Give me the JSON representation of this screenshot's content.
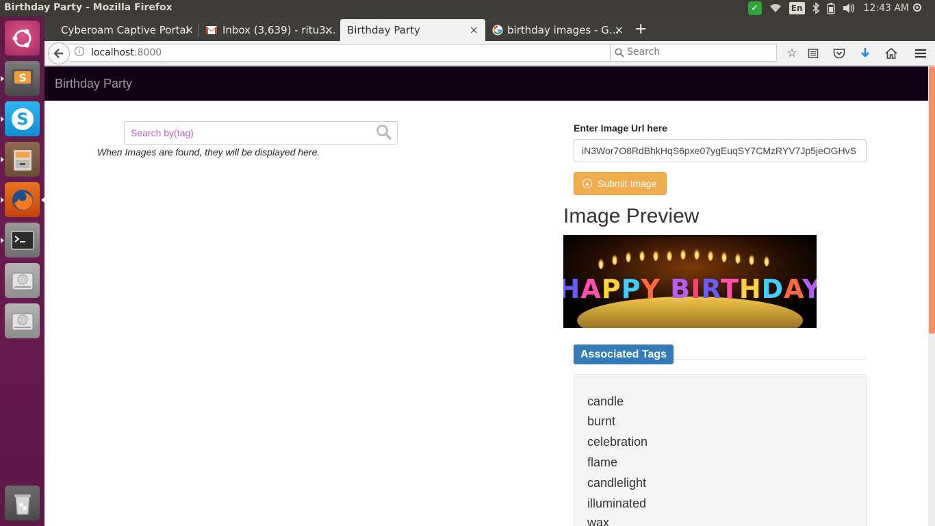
{
  "os": {
    "window_title": "Birthday Party - Mozilla Firefox",
    "keyboard_layout": "En",
    "clock": "12:43 AM"
  },
  "browser": {
    "tabs": [
      {
        "label": "Cyberoam Captive Portal",
        "favicon": "none"
      },
      {
        "label": "Inbox (3,639) - ritu3…",
        "favicon": "gmail-icon"
      },
      {
        "label": "Birthday Party",
        "favicon": "none",
        "active": true
      },
      {
        "label": "birthday images - G…",
        "favicon": "google-icon"
      }
    ],
    "close_glyph": "×",
    "new_tab_glyph": "+",
    "url_host": "localhost",
    "url_port": ":8000",
    "search_placeholder": "Search"
  },
  "page": {
    "brand": "Birthday Party",
    "tag_search_placeholder": "Search by(tag)",
    "results_hint": "When Images are found, they will be displayed here.",
    "url_label": "Enter Image Url here",
    "url_value": "iN3Wor7O8RdBhkHqS6pxe07ygEuqSY7CMzRYV7Jp5jeOGHvS",
    "submit_label": "Submit Image",
    "preview_title": "Image Preview",
    "preview_caption": "HAPPY BIRTHDAY",
    "tags_heading": "Associated Tags",
    "tags": [
      "candle",
      "burnt",
      "celebration",
      "flame",
      "candlelight",
      "illuminated",
      "wax"
    ]
  },
  "colors": {
    "navbar_bg": "#140016",
    "submit_button": "#f0ad4e",
    "tags_badge": "#337ab7",
    "search_placeholder": "#c05ec0",
    "scroll_thumb": "#f0926c"
  }
}
